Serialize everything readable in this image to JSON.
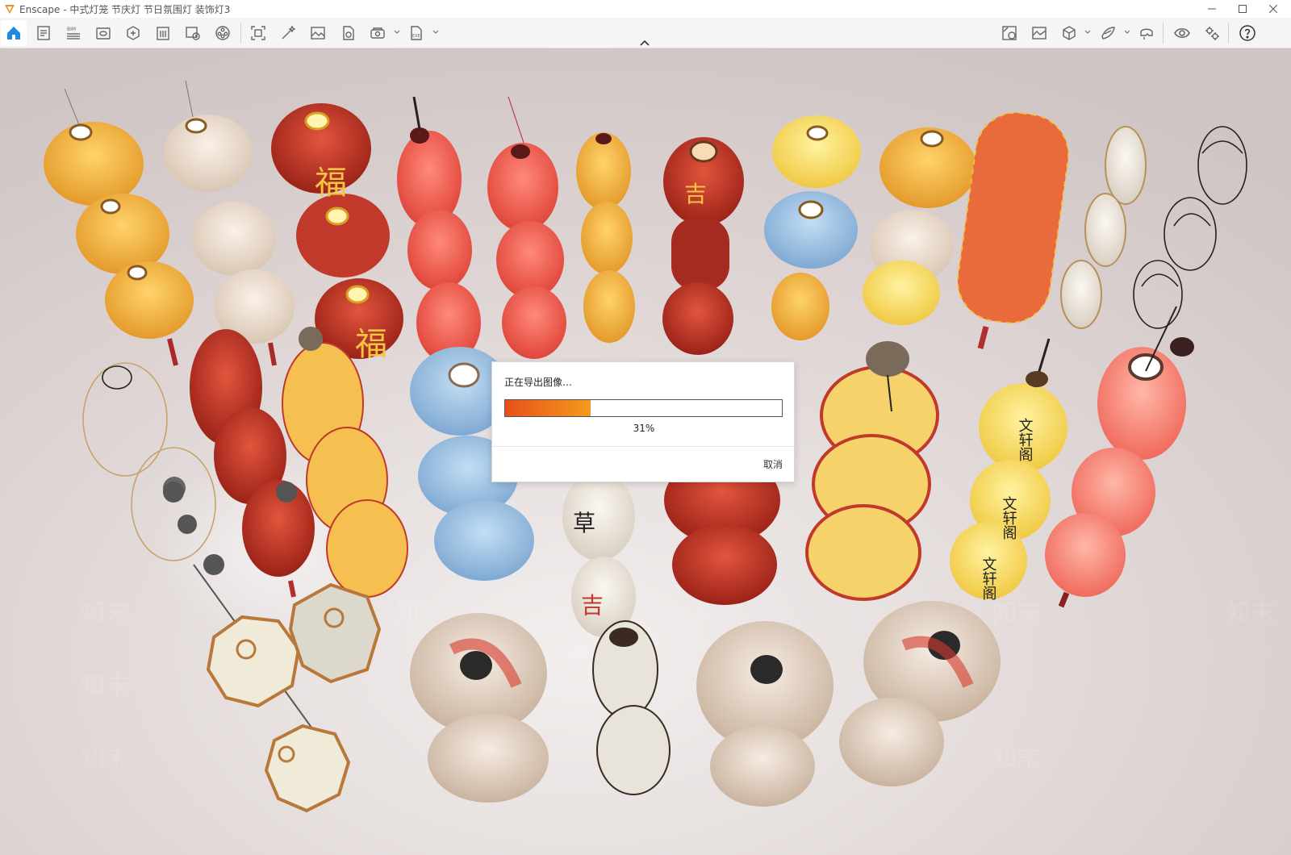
{
  "window": {
    "app_name": "Enscape",
    "title": "Enscape - 中式灯笼 节庆灯 节日氛围灯 装饰灯3",
    "controls": [
      "minimize",
      "maximize",
      "close"
    ]
  },
  "toolbar": {
    "left_buttons": [
      "home-icon",
      "document-icon",
      "bim-icon",
      "view-icon",
      "asset-icon",
      "building-icon",
      "visual-settings-icon",
      "video-icon",
      "capture-icon",
      "magic-wand-icon",
      "image-icon",
      "batch-icon",
      "panorama-icon",
      "exe-export-icon"
    ],
    "right_buttons": [
      "materials-icon",
      "gallery-icon",
      "cube-icon",
      "layers-icon",
      "vr-headset-icon",
      "eye-icon",
      "settings-icon",
      "help-icon"
    ],
    "active": "home-icon",
    "accent_color": "#1e88e5"
  },
  "dialog": {
    "title": "正在导出图像…",
    "progress": 0.31,
    "progress_text": "31%",
    "cancel_label": "取消",
    "progress_colors": [
      "#e8511a",
      "#f39a1e"
    ]
  },
  "scene": {
    "watermark": "知末",
    "lantern_text": {
      "fu": "福",
      "wenxuan": "文轩阁",
      "cao": "草",
      "ji": "吉"
    }
  }
}
